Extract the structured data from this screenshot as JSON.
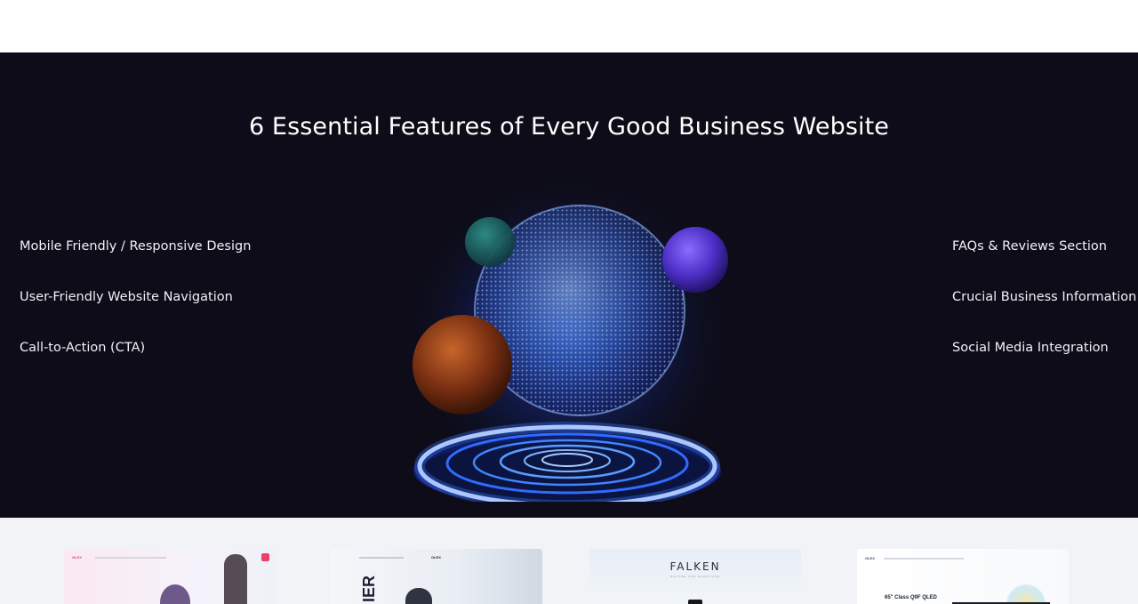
{
  "hero": {
    "title": "6 Essential Features of Every Good Business Website",
    "features_left": [
      {
        "label": "Mobile Friendly / Responsive Design"
      },
      {
        "label": "User-Friendly Website Navigation"
      },
      {
        "label": "Call-to-Action (CTA)"
      }
    ],
    "features_right": [
      {
        "label": "FAQs & Reviews Section"
      },
      {
        "label": "Crucial Business Information"
      },
      {
        "label": "Social Media Integration"
      }
    ]
  },
  "gallery": {
    "thumbnails": [
      {
        "logo": "OLEX"
      },
      {
        "logo": "OLEX",
        "big_text": "IER"
      },
      {
        "logo": "FALKEN",
        "tagline": "NATURE FOR EVERYONE"
      },
      {
        "logo": "OLEX",
        "headline": "65\" Class Q9F QLED"
      }
    ]
  },
  "colors": {
    "hero_background": "#0d0c18",
    "gallery_background": "#f1f3f7",
    "accent_blue": "#2f6bff"
  }
}
